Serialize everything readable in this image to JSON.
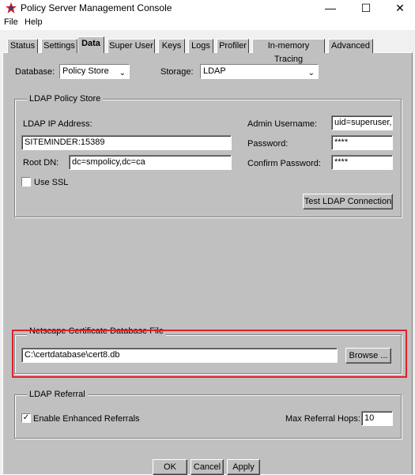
{
  "window": {
    "title": "Policy Server Management Console"
  },
  "menu": {
    "file": "File",
    "help": "Help"
  },
  "tabs": [
    {
      "label": "Status"
    },
    {
      "label": "Settings"
    },
    {
      "label": "Data"
    },
    {
      "label": "Super User"
    },
    {
      "label": "Keys"
    },
    {
      "label": "Logs"
    },
    {
      "label": "Profiler"
    },
    {
      "label": "In-memory Tracing"
    },
    {
      "label": "Advanced"
    }
  ],
  "database": {
    "label": "Database:",
    "value": "Policy Store"
  },
  "storage": {
    "label": "Storage:",
    "value": "LDAP"
  },
  "ldap_store": {
    "title": "LDAP Policy Store",
    "ip_label": "LDAP IP Address:",
    "ip_value": "SITEMINDER:15389",
    "root_label": "Root DN:",
    "root_value": "dc=smpolicy,dc=ca",
    "ssl_label": "Use SSL",
    "admin_label": "Admin Username:",
    "admin_value": "uid=superuser,d",
    "password_label": "Password:",
    "password_value": "****",
    "confirm_label": "Confirm Password:",
    "confirm_value": "****",
    "test_button": "Test LDAP Connection"
  },
  "cert": {
    "title": "Netscape Certificate Database File",
    "path": "C:\\certdatabase\\cert8.db",
    "browse": "Browse ..."
  },
  "referral": {
    "title": "LDAP Referral",
    "enhanced_label": "Enable Enhanced Referrals",
    "enhanced_checked": "✓",
    "hops_label": "Max Referral Hops:",
    "hops_value": "10"
  },
  "footer": {
    "ok": "OK",
    "cancel": "Cancel",
    "apply": "Apply"
  },
  "colors": {
    "highlight": "#e0202a",
    "face": "#c0c0c0"
  }
}
